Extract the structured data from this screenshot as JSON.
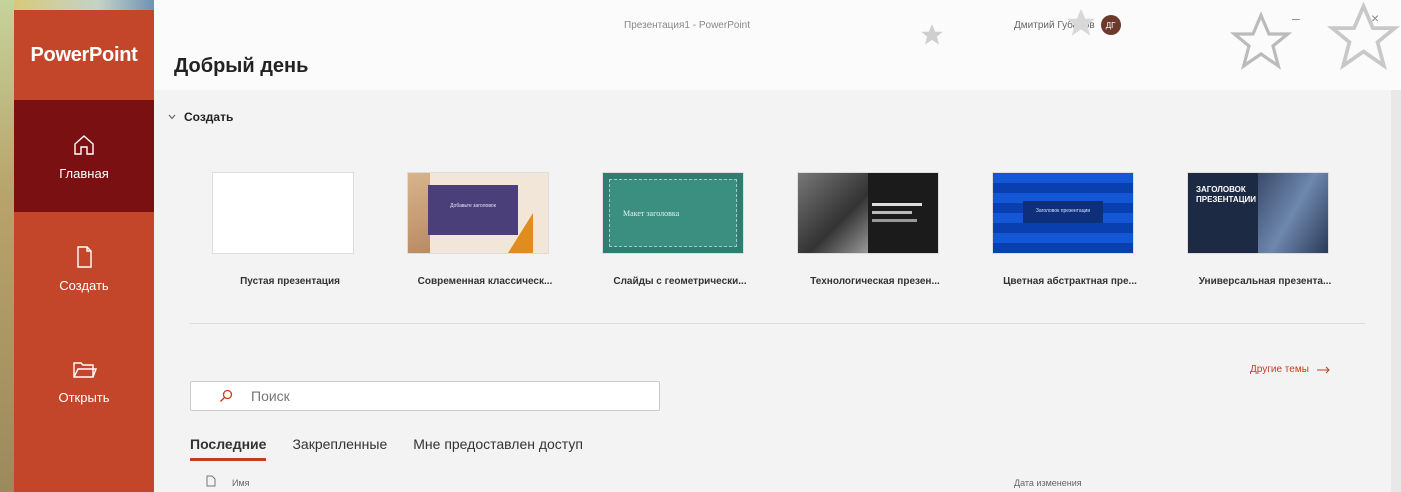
{
  "app": {
    "name": "PowerPoint",
    "window_title": "Презентация1 - PowerPoint"
  },
  "user": {
    "name": "Дмитрий Губанов",
    "initials": "ДГ"
  },
  "nav": [
    {
      "label": "Главная",
      "icon": "home-icon"
    },
    {
      "label": "Создать",
      "icon": "new-file-icon"
    },
    {
      "label": "Открыть",
      "icon": "folder-open-icon"
    }
  ],
  "header": {
    "greeting": "Добрый день"
  },
  "create": {
    "section_label": "Создать",
    "templates": [
      {
        "name": "Пустая презентация"
      },
      {
        "name": "Современная классическ..."
      },
      {
        "name": "Слайды с геометрически..."
      },
      {
        "name": "Технологическая презен..."
      },
      {
        "name": "Цветная абстрактная пре..."
      },
      {
        "name": "Универсальная презента..."
      }
    ],
    "more_themes": "Другие темы",
    "thumb_texts": {
      "t2": "Добавьте заголовок",
      "t3": "Макет заголовка",
      "t5": "Заголовок презентации",
      "t6": "ЗАГОЛОВОК ПРЕЗЕНТАЦИИ"
    }
  },
  "search": {
    "placeholder": "Поиск"
  },
  "tabs": [
    {
      "label": "Последние",
      "active": true
    },
    {
      "label": "Закрепленные",
      "active": false
    },
    {
      "label": "Мне предоставлен доступ",
      "active": false
    }
  ],
  "list": {
    "col_name": "Имя",
    "col_date": "Дата изменения"
  }
}
